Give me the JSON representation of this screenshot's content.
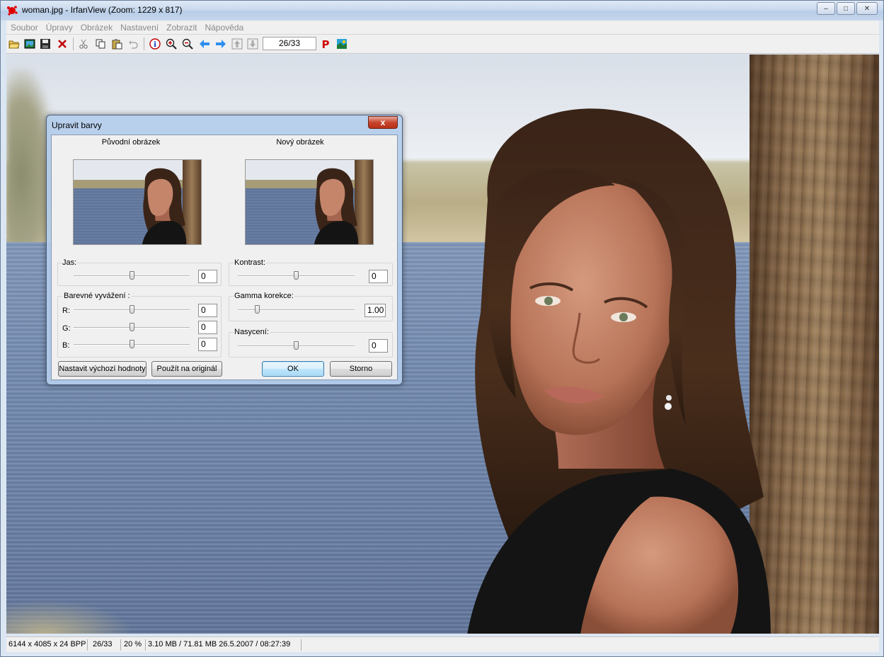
{
  "window": {
    "title": "woman.jpg - IrfanView (Zoom: 1229 x 817)",
    "minimize": "‒",
    "maximize": "□",
    "close": "✕"
  },
  "menu": [
    "Soubor",
    "Úpravy",
    "Obrázek",
    "Nastavení",
    "Zobrazit",
    "Nápověda"
  ],
  "toolbar": {
    "page_counter": "26/33",
    "buttons": [
      "open-folder",
      "slideshow",
      "save",
      "delete",
      "cut",
      "copy",
      "paste",
      "undo",
      "info",
      "zoom-in",
      "zoom-out",
      "previous",
      "next",
      "move-up",
      "move-down",
      "print",
      "paint"
    ]
  },
  "statusbar": {
    "dimensions": "6144 x 4085 x 24 BPP",
    "index": "26/33",
    "zoom": "20 %",
    "fileinfo": "3.10 MB / 71.81 MB 26.5.2007 / 08:27:39"
  },
  "dialog": {
    "title": "Upravit barvy",
    "close": "x",
    "original_label": "Původní obrázek",
    "new_label": "Nový obrázek",
    "brightness": {
      "label": "Jas:",
      "value": "0",
      "position": 0.5
    },
    "contrast": {
      "label": "Kontrast:",
      "value": "0",
      "position": 0.5
    },
    "color_balance": {
      "label": "Barevné vyvážení :",
      "r": {
        "label": "R:",
        "value": "0",
        "position": 0.5
      },
      "g": {
        "label": "G:",
        "value": "0",
        "position": 0.5
      },
      "b": {
        "label": "B:",
        "value": "0",
        "position": 0.5
      }
    },
    "gamma": {
      "label": "Gamma korekce:",
      "value": "1.00",
      "position": 0.15
    },
    "saturation": {
      "label": "Nasycení:",
      "value": "0",
      "position": 0.5
    },
    "buttons": {
      "defaults": "Nastavit výchozí hodnoty",
      "apply": "Použít na originál",
      "ok": "OK",
      "cancel": "Storno"
    }
  },
  "colors": {
    "accent": "#3c7fb1",
    "close_red": "#c7452d",
    "menu_disabled": "#8a8a8a"
  }
}
